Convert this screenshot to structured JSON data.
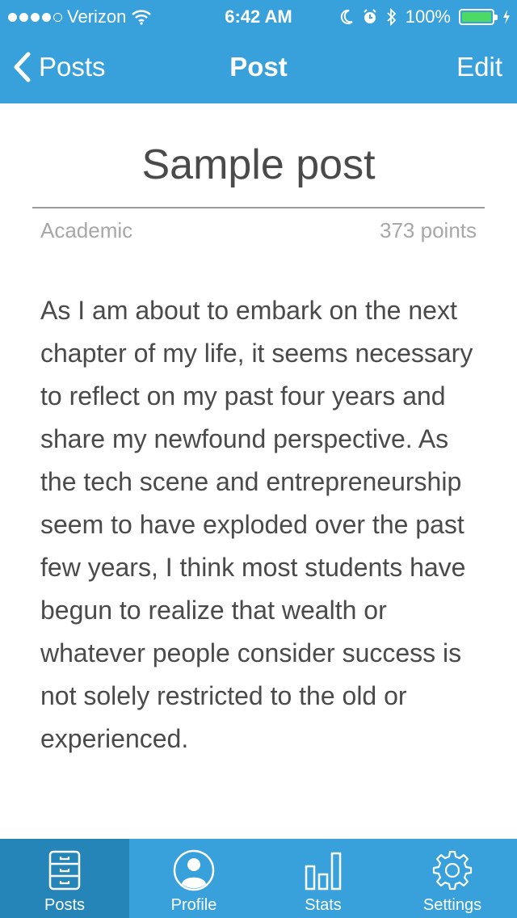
{
  "status_bar": {
    "carrier": "Verizon",
    "time": "6:42 AM",
    "battery": "100%",
    "signal_bars_filled": 4,
    "signal_bars_total": 5,
    "icons": [
      "wifi-icon",
      "moon-icon",
      "alarm-icon",
      "bluetooth-icon",
      "battery-icon",
      "charging-icon"
    ]
  },
  "nav": {
    "back_label": "Posts",
    "title": "Post",
    "edit_label": "Edit"
  },
  "post": {
    "title": "Sample post",
    "category": "Academic",
    "points": "373 points",
    "body": "As I am about to embark on the next chapter of my life, it seems necessary to reflect on my past four years and share my newfound perspective. As the tech scene and entrepreneurship seem to have exploded over the past few years, I think most students have begun to realize that wealth or whatever people consider success is not solely restricted to the old or experienced."
  },
  "tabs": [
    {
      "label": "Posts",
      "icon": "file-cabinet-icon",
      "active": true
    },
    {
      "label": "Profile",
      "icon": "person-icon",
      "active": false
    },
    {
      "label": "Stats",
      "icon": "bar-chart-icon",
      "active": false
    },
    {
      "label": "Settings",
      "icon": "gear-icon",
      "active": false
    }
  ],
  "colors": {
    "brand_blue": "#38a0db",
    "active_tab": "#2584b8",
    "text": "#4a4a4a",
    "muted": "#a7a7a7",
    "battery_green": "#4cd964"
  }
}
